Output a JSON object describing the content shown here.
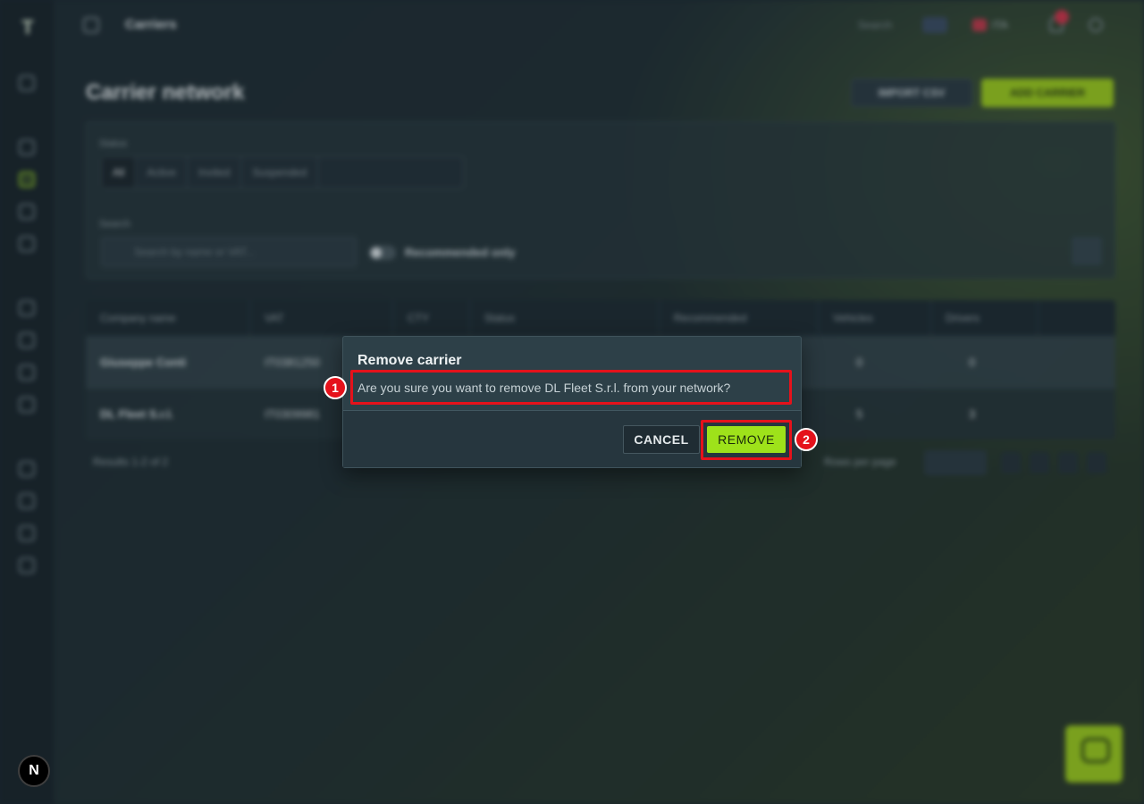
{
  "topbar": {
    "breadcrumb": "Carriers",
    "search_label": "Search",
    "language": "ITA"
  },
  "page": {
    "title": "Carrier network",
    "import_label": "IMPORT CSV",
    "add_label": "ADD CARRIER"
  },
  "filters": {
    "status_label": "Status",
    "status_tabs": [
      {
        "label": "All"
      },
      {
        "label": "Active"
      },
      {
        "label": "Invited"
      },
      {
        "label": "Suspended"
      }
    ],
    "search_label": "Search",
    "search_placeholder": "Search by name or VAT...",
    "recommended_label": "Recommended only"
  },
  "table": {
    "columns": [
      "Company name",
      "VAT",
      "CTY",
      "Status",
      "Recommended",
      "Vehicles",
      "Drivers",
      ""
    ],
    "rows": [
      {
        "name": "Giuseppe Conti",
        "vat": "IT0381250",
        "vehicles": "0",
        "drivers": "0"
      },
      {
        "name": "DL Fleet S.r.l.",
        "vat": "IT0309981",
        "vehicles": "5",
        "drivers": "3"
      }
    ],
    "results": "Results 1-2 of 2",
    "rows_per_page": "Rows per page"
  },
  "dialog": {
    "title": "Remove carrier",
    "message": "Are you sure you want to remove DL Fleet S.r.l. from your network?",
    "cancel_label": "CANCEL",
    "remove_label": "REMOVE"
  },
  "annotations": [
    {
      "number": "1"
    },
    {
      "number": "2"
    }
  ],
  "badge": {
    "letter": "N"
  },
  "colors": {
    "accent": "#9ee21a",
    "annotation": "#e5121b",
    "dialog_bg": "#2d4048"
  }
}
